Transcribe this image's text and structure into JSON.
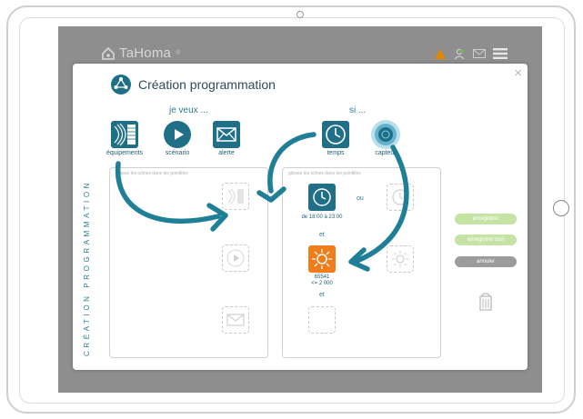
{
  "app": {
    "logo_text": "TaHoma",
    "logo_mark": "®"
  },
  "modal": {
    "title": "Création programmation",
    "vertical_label": "CRÉATION PROGRAMMATION",
    "close": "×",
    "left_heading": "je veux ...",
    "right_heading": "si ...",
    "palette_left": [
      {
        "label": "équipements",
        "icon": "equipment-icon"
      },
      {
        "label": "scénario",
        "icon": "play-icon"
      },
      {
        "label": "alerte",
        "icon": "envelope-icon"
      }
    ],
    "palette_right": [
      {
        "label": "temps",
        "icon": "clock-icon"
      },
      {
        "label": "capteur",
        "icon": "sensor-icon"
      }
    ],
    "left_panel_hint": "glissez les icônes dans les pointillés",
    "right_panel_hint": "glissez les icônes dans les pointillés",
    "time_condition_text": "de 18:00 à 23:00",
    "or_label": "ou",
    "and_label_1": "et",
    "and_label_2": "et",
    "sensor_id": "65541",
    "sensor_threshold": "<= 2 000",
    "buttons": {
      "save": "enregistrer",
      "save_close": "enregistrer tout",
      "cancel": "annuler"
    }
  },
  "colors": {
    "accent": "#1f6f87",
    "sun_orange": "#f07d1a",
    "save_green": "#c6e3a6",
    "cancel_grey": "#9c9c9c",
    "alert_orange": "#e08a00"
  }
}
